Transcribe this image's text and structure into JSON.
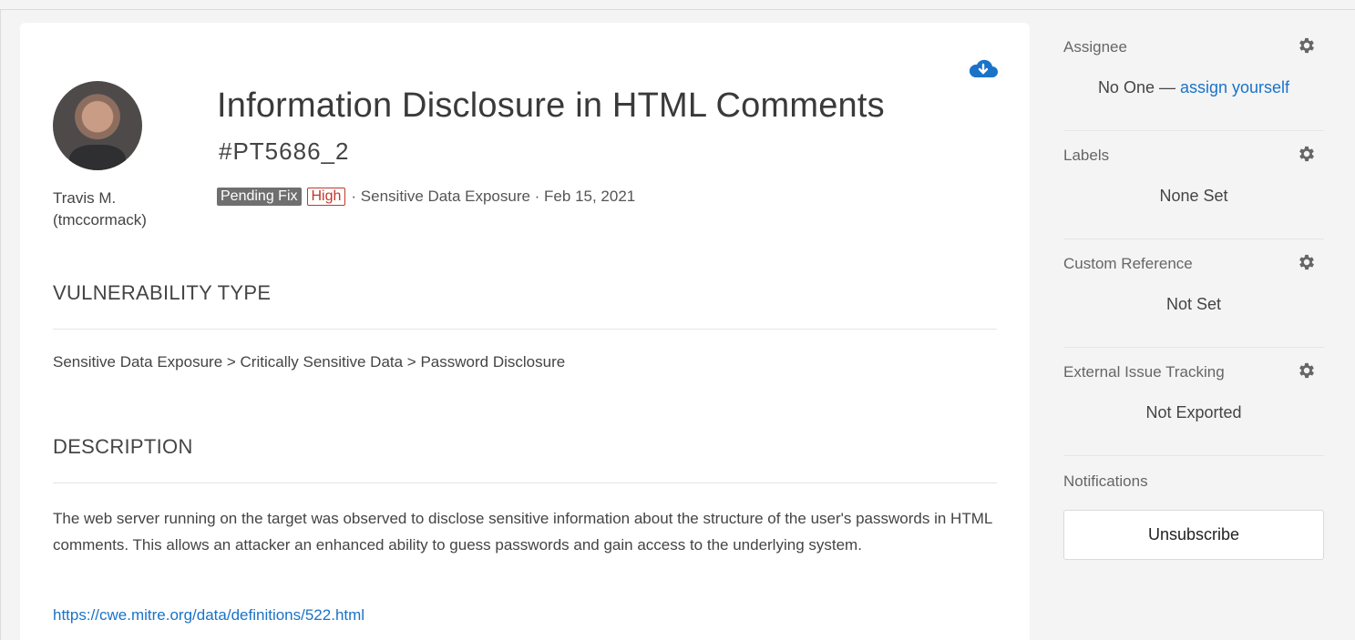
{
  "report": {
    "title": "Information Disclosure in HTML Comments",
    "id": "#PT5686_2",
    "status": "Pending Fix",
    "severity": "High",
    "category_meta": "· Sensitive Data Exposure · Feb 15, 2021"
  },
  "author": {
    "name": "Travis M. (tmccormack)"
  },
  "sections": {
    "vuln_type_heading": "VULNERABILITY TYPE",
    "vuln_type_value": "Sensitive Data Exposure > Critically Sensitive Data > Password Disclosure",
    "description_heading": "DESCRIPTION",
    "description_text": "The web server running on the target was observed to disclose sensitive information about the structure of the user's passwords in HTML comments. This allows an attacker an enhanced ability to guess passwords and gain access to the underlying system.",
    "reference_link": "https://cwe.mitre.org/data/definitions/522.html"
  },
  "sidebar": {
    "assignee_label": "Assignee",
    "assignee_value": "No One — ",
    "assignee_link": "assign yourself",
    "labels_label": "Labels",
    "labels_value": "None Set",
    "custom_ref_label": "Custom Reference",
    "custom_ref_value": "Not Set",
    "external_label": "External Issue Tracking",
    "external_value": "Not Exported",
    "notifications_label": "Notifications",
    "unsubscribe_label": "Unsubscribe"
  },
  "colors": {
    "link": "#1a73c8",
    "severity_high": "#c0392b",
    "status_badge": "#6f6f6f"
  },
  "icons": [
    "cloud-download-icon",
    "gear-icon"
  ]
}
